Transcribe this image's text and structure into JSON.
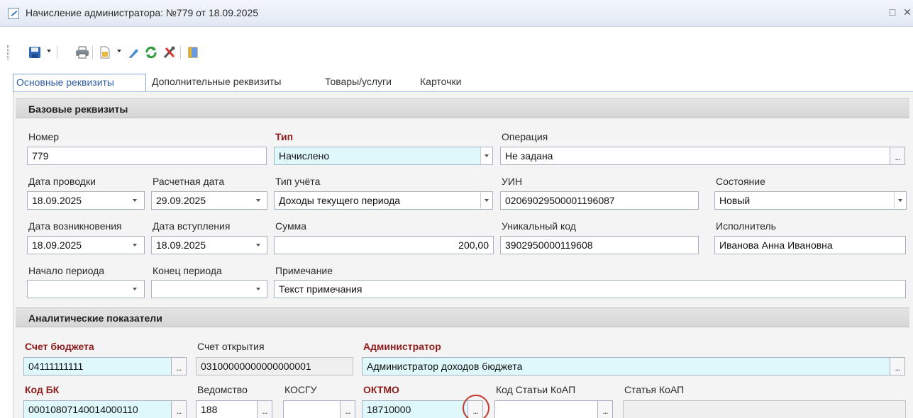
{
  "window": {
    "title": "Начисление администратора: №779 от 18.09.2025",
    "controls": [
      "restore",
      "close"
    ]
  },
  "toolbar": {
    "buttons": [
      "save-icon",
      "print-icon",
      "document-icon",
      "pencil-icon",
      "refresh-icon",
      "tools-icon",
      "exit-icon"
    ]
  },
  "tabs": [
    "Основные реквизиты",
    "Дополнительные реквизиты",
    "Товары/услуги",
    "Карточки"
  ],
  "basic": {
    "header": "Базовые реквизиты",
    "nomer": {
      "label": "Номер",
      "value": "779"
    },
    "tip": {
      "label": "Тип",
      "value": "Начислено"
    },
    "operaciya": {
      "label": "Операция",
      "value": "Не задана"
    },
    "data_provodki": {
      "label": "Дата проводки",
      "value": "18.09.2025"
    },
    "raschetnaya_data": {
      "label": "Расчетная дата",
      "value": "29.09.2025"
    },
    "tip_ucheta": {
      "label": "Тип учёта",
      "value": "Доходы текущего периода"
    },
    "uin": {
      "label": "УИН",
      "value": "02069029500001196087"
    },
    "sostoyanie": {
      "label": "Состояние",
      "value": "Новый"
    },
    "data_vozniknoveniya": {
      "label": "Дата возникновения",
      "value": "18.09.2025"
    },
    "data_vstupleniya": {
      "label": "Дата вступления",
      "value": "18.09.2025"
    },
    "summa": {
      "label": "Сумма",
      "value": "200,00"
    },
    "unikalny_kod": {
      "label": "Уникальный код",
      "value": "3902950000119608"
    },
    "ispolnitel": {
      "label": "Исполнитель",
      "value": "Иванова Анна Ивановна"
    },
    "nachalo_perioda": {
      "label": "Начало периода",
      "value": ""
    },
    "konec_perioda": {
      "label": "Конец периода",
      "value": ""
    },
    "primechanie": {
      "label": "Примечание",
      "value": "Текст примечания"
    }
  },
  "analytics": {
    "header": "Аналитические показатели",
    "schet_byudzheta": {
      "label": "Счет бюджета",
      "value": "04111111111"
    },
    "schet_otkrytiya": {
      "label": "Счет открытия",
      "value": "03100000000000000001"
    },
    "administrator": {
      "label": "Администратор",
      "value": "Администратор доходов бюджета"
    },
    "kod_bk": {
      "label": "Код БК",
      "value": "00010807140014000110"
    },
    "vedomstvo": {
      "label": "Ведомство",
      "value": "188"
    },
    "kosgu": {
      "label": "КОСГУ",
      "value": ""
    },
    "oktmo": {
      "label": "ОКТМО",
      "value": "18710000"
    },
    "kod_stati_koap": {
      "label": "Код Статьи КоАП",
      "value": ""
    },
    "statya_koap": {
      "label": "Статья КоАП",
      "value": ""
    }
  },
  "ellipsis": "...",
  "colors": {
    "required_label": "#8e1c1c",
    "required_field": "#dff8fb",
    "active_tab": "#2f5fa8",
    "highlight": "#c0392b"
  }
}
